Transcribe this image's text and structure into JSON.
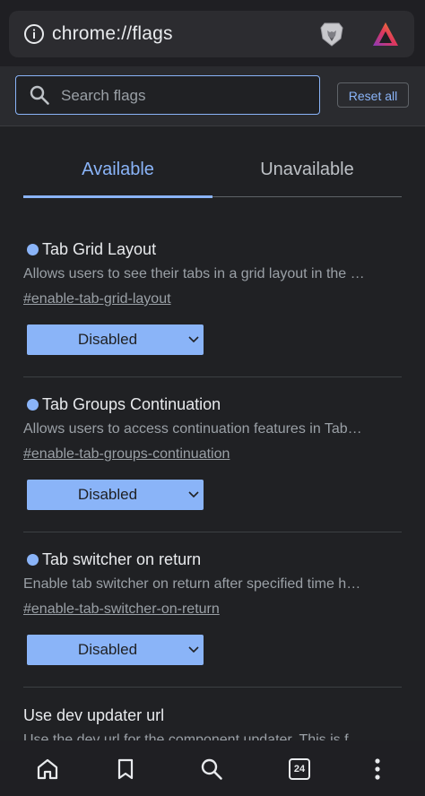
{
  "address_bar": {
    "url": "chrome://flags",
    "icons": [
      "info-icon",
      "brave-lion-icon",
      "brave-rewards-icon"
    ]
  },
  "search": {
    "placeholder": "Search flags",
    "value": "",
    "reset_label": "Reset all"
  },
  "tabs": [
    {
      "label": "Available",
      "active": true
    },
    {
      "label": "Unavailable",
      "active": false
    }
  ],
  "experiments": [
    {
      "title": "Tab Grid Layout",
      "description": "Allows users to see their tabs in a grid layout in the …",
      "link": "#enable-tab-grid-layout",
      "value": "Disabled",
      "modified_dot": true
    },
    {
      "title": "Tab Groups Continuation",
      "description": "Allows users to access continuation features in Tab…",
      "link": "#enable-tab-groups-continuation",
      "value": "Disabled",
      "modified_dot": true
    },
    {
      "title": "Tab switcher on return",
      "description": "Enable tab switcher on return after specified time h…",
      "link": "#enable-tab-switcher-on-return",
      "value": "Disabled",
      "modified_dot": true
    },
    {
      "title": "Use dev updater url",
      "description": "Use the dev url for the component updater. This is f…",
      "modified_dot": false
    }
  ],
  "bottom_bar": {
    "tab_count": "24",
    "icons": [
      "home-icon",
      "bookmark-icon",
      "search-icon",
      "tabs-icon",
      "more-vert-icon"
    ]
  },
  "colors": {
    "accent": "#8ab4f8",
    "background": "#202124",
    "text": "#e8eaed",
    "secondary_text": "#9aa0a6"
  }
}
